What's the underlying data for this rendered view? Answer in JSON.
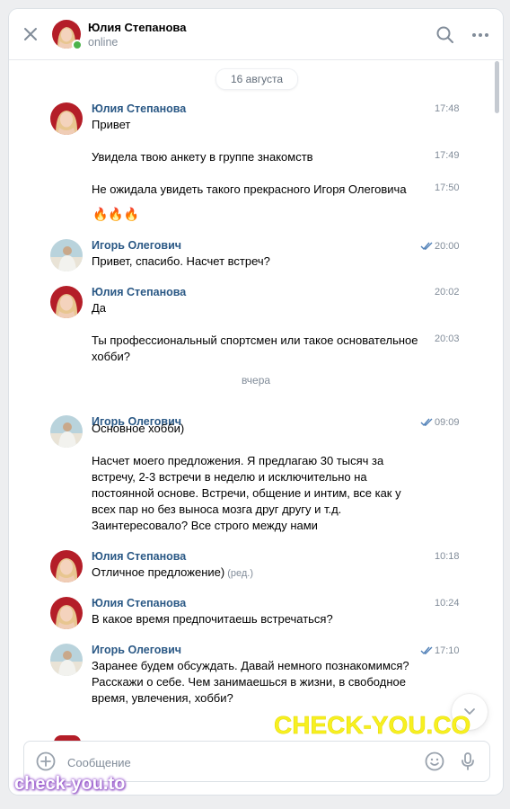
{
  "header": {
    "name": "Юлия Степанова",
    "status": "online",
    "icons": [
      "close-icon",
      "search-icon",
      "more-icon"
    ]
  },
  "dates": {
    "first": "16 августа",
    "second": "вчера"
  },
  "messages": [
    {
      "sender": "Юлия Степанова",
      "time": "17:48",
      "text": "Привет"
    },
    {
      "time": "17:49",
      "text": "Увидела твою анкету в группе знакомств"
    },
    {
      "time": "17:50",
      "text": "Не ожидала увидеть такого прекрасного Игоря Олеговича",
      "emoji": "🔥🔥🔥"
    },
    {
      "sender": "Игорь Олегович",
      "time": "20:00",
      "text": "Привет, спасибо. Насчет встреч?",
      "read": true
    },
    {
      "sender": "Юлия Степанова",
      "time": "20:02",
      "text": "Да"
    },
    {
      "time": "20:03",
      "text": "Ты профессиональный спортсмен или такое основательное хобби?"
    },
    {
      "sender": "Игорь Олегович",
      "time": "09:09",
      "text": "Основное хобби)",
      "read": true
    },
    {
      "text": "Насчет моего предложения. Я предлагаю 30 тысяч за встречу, 2-3 встречи в неделю и исключительно на постоянной основе. Встречи, общение и интим, все как у всех пар но без выноса мозга друг другу и т.д. Заинтересовало? Все строго между нами"
    },
    {
      "sender": "Юлия Степанова",
      "time": "10:18",
      "text": "Отличное предложение)",
      "edited": "(ред.)"
    },
    {
      "sender": "Юлия Степанова",
      "time": "10:24",
      "text": "В какое время предпочитаешь встречаться?"
    },
    {
      "sender": "Игорь Олегович",
      "time": "17:10",
      "text": "Заранее будем обсуждать. Давай немного познакомимся?\nРасскажи о себе. Чем занимаешься в жизни, в свободное время, увлечения, хобби?",
      "read": true
    }
  ],
  "composer": {
    "placeholder": "Сообщение"
  },
  "watermarks": {
    "big": "CHECK-YOU.CO",
    "small": "check-you.to"
  },
  "colors": {
    "link": "#2a5885",
    "online": "#4bb34b",
    "tick": "#5181b8",
    "background": "#edeef0"
  }
}
